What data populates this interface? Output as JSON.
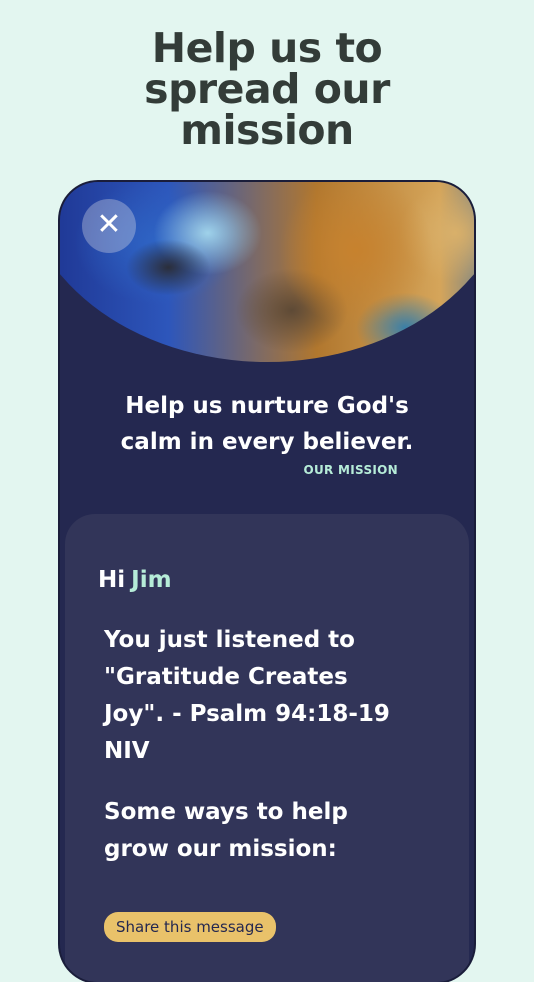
{
  "headline": {
    "line1": "Help us to",
    "line2": "spread our",
    "line3": "mission"
  },
  "phone": {
    "close_icon": "close-icon",
    "mission_line1": "Help us nurture God's",
    "mission_line2": "calm in every believer.",
    "mission_label": "OUR MISSION",
    "greeting": "Hi",
    "user_name": "Jim",
    "listened_line1": "You just listened to",
    "listened_line2": "\"Gratitude Creates",
    "listened_line3": "Joy\".  - Psalm 94:18-19",
    "listened_line4": "NIV",
    "ways_line1": "Some ways to help",
    "ways_line2": "grow our mission:",
    "share_button": "Share this message"
  },
  "colors": {
    "background": "#e3f6f0",
    "phone": "#242850",
    "card": "#323559",
    "accent": "#b6ecd8",
    "button": "#e9c26a"
  }
}
